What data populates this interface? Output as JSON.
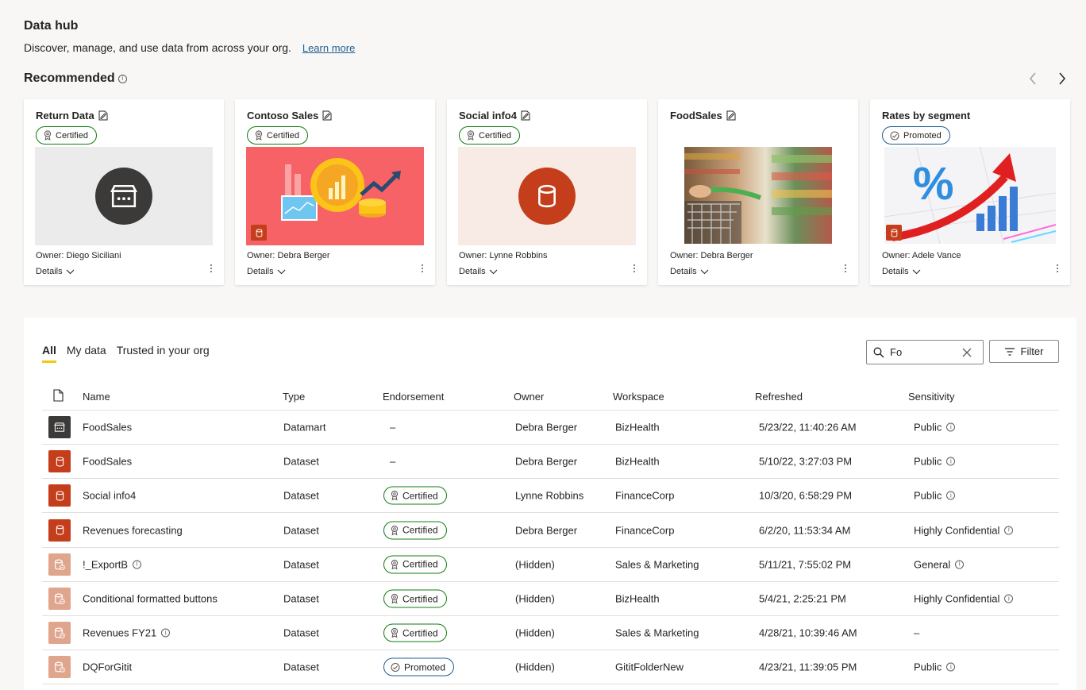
{
  "header": {
    "title": "Data hub",
    "subtitle": "Discover, manage, and use data from across your org.",
    "learn_more": "Learn more"
  },
  "recommended": {
    "title": "Recommended",
    "cards": [
      {
        "title": "Return Data",
        "badge": "Certified",
        "owner": "Owner: Diego Siciliani",
        "details": "Details",
        "media": "datamart-icon"
      },
      {
        "title": "Contoso Sales",
        "badge": "Certified",
        "owner": "Owner: Debra Berger",
        "details": "Details",
        "media": "coins-growth-illustration"
      },
      {
        "title": "Social info4",
        "badge": "Certified",
        "owner": "Owner: Lynne Robbins",
        "details": "Details",
        "media": "dataset-icon"
      },
      {
        "title": "FoodSales",
        "badge": "",
        "owner": "Owner: Debra Berger",
        "details": "Details",
        "media": "supermarket-photo"
      },
      {
        "title": "Rates by segment",
        "badge": "Promoted",
        "owner": "Owner: Adele Vance",
        "details": "Details",
        "media": "percent-chart-illustration"
      }
    ]
  },
  "tabs": [
    {
      "label": "All",
      "active": true
    },
    {
      "label": "My data",
      "active": false
    },
    {
      "label": "Trusted in your org",
      "active": false
    }
  ],
  "search": {
    "value": "Fo"
  },
  "filter_label": "Filter",
  "table": {
    "columns": [
      "Name",
      "Type",
      "Endorsement",
      "Owner",
      "Workspace",
      "Refreshed",
      "Sensitivity"
    ],
    "rows": [
      {
        "icon": "datamart",
        "name": "FoodSales",
        "name_info": false,
        "type": "Datamart",
        "endorsement": "–",
        "owner": "Debra Berger",
        "workspace": "BizHealth",
        "refreshed": "5/23/22, 11:40:26 AM",
        "sensitivity": "Public",
        "sens_info": true
      },
      {
        "icon": "dataset",
        "name": "FoodSales",
        "name_info": false,
        "type": "Dataset",
        "endorsement": "–",
        "owner": "Debra Berger",
        "workspace": "BizHealth",
        "refreshed": "5/10/22, 3:27:03 PM",
        "sensitivity": "Public",
        "sens_info": true
      },
      {
        "icon": "dataset",
        "name": "Social info4",
        "name_info": false,
        "type": "Dataset",
        "endorsement": "Certified",
        "owner": "Lynne Robbins",
        "workspace": "FinanceCorp",
        "refreshed": "10/3/20, 6:58:29 PM",
        "sensitivity": "Public",
        "sens_info": true
      },
      {
        "icon": "dataset",
        "name": "Revenues forecasting",
        "name_info": false,
        "type": "Dataset",
        "endorsement": "Certified",
        "owner": "Debra Berger",
        "workspace": "FinanceCorp",
        "refreshed": "6/2/20, 11:53:34 AM",
        "sensitivity": "Highly Confidential",
        "sens_info": true
      },
      {
        "icon": "dataset-light",
        "name": "!_ExportB",
        "name_info": true,
        "type": "Dataset",
        "endorsement": "Certified",
        "owner": "(Hidden)",
        "workspace": "Sales & Marketing",
        "refreshed": "5/11/21, 7:55:02 PM",
        "sensitivity": "General",
        "sens_info": true
      },
      {
        "icon": "dataset-light",
        "name": "Conditional formatted buttons",
        "name_info": false,
        "type": "Dataset",
        "endorsement": "Certified",
        "owner": "(Hidden)",
        "workspace": "BizHealth",
        "refreshed": "5/4/21, 2:25:21 PM",
        "sensitivity": "Highly Confidential",
        "sens_info": true
      },
      {
        "icon": "dataset-light",
        "name": "Revenues FY21",
        "name_info": true,
        "type": "Dataset",
        "endorsement": "Certified",
        "owner": "(Hidden)",
        "workspace": "Sales & Marketing",
        "refreshed": "4/28/21, 10:39:46 AM",
        "sensitivity": "–",
        "sens_info": false
      },
      {
        "icon": "dataset-light",
        "name": "DQForGitit",
        "name_info": false,
        "type": "Dataset",
        "endorsement": "Promoted",
        "owner": "(Hidden)",
        "workspace": "GititFolderNew",
        "refreshed": "4/23/21, 11:39:05 PM",
        "sensitivity": "Public",
        "sens_info": true
      }
    ]
  },
  "colors": {
    "certified": "#107c10",
    "promoted": "#1f5d8f",
    "dataset": "#c43e1c",
    "dataset_light": "#e0a58d",
    "datamart": "#3b3a39",
    "tab_indicator": "#f2c811"
  }
}
